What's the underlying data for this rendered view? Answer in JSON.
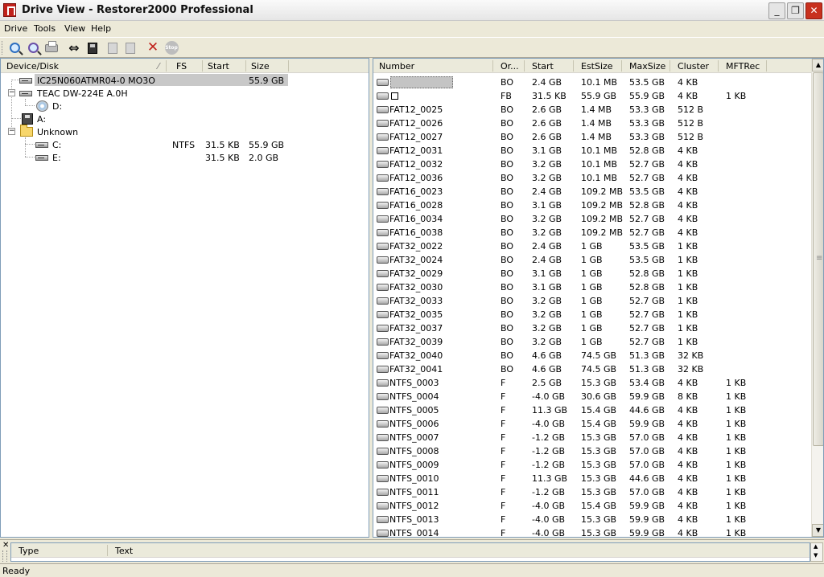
{
  "window": {
    "title": "Drive View - Restorer2000 Professional",
    "minimize_label": "_",
    "maximize_label": "❐",
    "close_label": "✕"
  },
  "menu": [
    "Drive",
    "Tools",
    "View",
    "Help"
  ],
  "toolbar": {
    "icons": [
      "find-partitions-icon",
      "find-files-icon",
      "print-icon",
      "swap-icon",
      "open-disk-icon",
      "copy-disabled-icon",
      "paste-disabled-icon",
      "delete-icon",
      "stop-icon"
    ],
    "swap_glyph": "⇔",
    "delete_glyph": "✕",
    "stop_glyph": "Stop"
  },
  "tree": {
    "headers": [
      "Device/Disk",
      "FS",
      "Start",
      "Size"
    ],
    "sort_glyph": "⁄",
    "expander_glyph": "−",
    "rows": [
      {
        "label": "IC25N060ATMR04-0 MO3O",
        "fs": "",
        "start": "",
        "size": "55.9 GB",
        "icon": "hard-disk-icon"
      },
      {
        "label": "TEAC DW-224E A.0H",
        "fs": "",
        "start": "",
        "size": "",
        "icon": "optical-drive-icon"
      },
      {
        "label": "D:",
        "fs": "",
        "start": "",
        "size": "",
        "icon": "cd-icon"
      },
      {
        "label": "A:",
        "fs": "",
        "start": "",
        "size": "",
        "icon": "floppy-icon"
      },
      {
        "label": "Unknown",
        "fs": "",
        "start": "",
        "size": "",
        "icon": "folder-icon"
      },
      {
        "label": "C:",
        "fs": "NTFS",
        "start": "31.5 KB",
        "size": "55.9 GB",
        "icon": "partition-icon"
      },
      {
        "label": "E:",
        "fs": "",
        "start": "31.5 KB",
        "size": "2.0 GB",
        "icon": "partition-icon"
      }
    ]
  },
  "list": {
    "headers": [
      "Number",
      "Or...",
      "Start",
      "EstSize",
      "MaxSize",
      "Cluster",
      "MFTRec"
    ],
    "rows": [
      {
        "number": "",
        "or": "BO",
        "start": "2.4 GB",
        "est": "10.1 MB",
        "max": "53.5 GB",
        "cluster": "4 KB",
        "mft": ""
      },
      {
        "number": "",
        "or": "FB",
        "start": "31.5 KB",
        "est": "55.9 GB",
        "max": "55.9 GB",
        "cluster": "4 KB",
        "mft": "1 KB"
      },
      {
        "number": "FAT12_0025",
        "or": "BO",
        "start": "2.6 GB",
        "est": "1.4 MB",
        "max": "53.3 GB",
        "cluster": "512 B",
        "mft": ""
      },
      {
        "number": "FAT12_0026",
        "or": "BO",
        "start": "2.6 GB",
        "est": "1.4 MB",
        "max": "53.3 GB",
        "cluster": "512 B",
        "mft": ""
      },
      {
        "number": "FAT12_0027",
        "or": "BO",
        "start": "2.6 GB",
        "est": "1.4 MB",
        "max": "53.3 GB",
        "cluster": "512 B",
        "mft": ""
      },
      {
        "number": "FAT12_0031",
        "or": "BO",
        "start": "3.1 GB",
        "est": "10.1 MB",
        "max": "52.8 GB",
        "cluster": "4 KB",
        "mft": ""
      },
      {
        "number": "FAT12_0032",
        "or": "BO",
        "start": "3.2 GB",
        "est": "10.1 MB",
        "max": "52.7 GB",
        "cluster": "4 KB",
        "mft": ""
      },
      {
        "number": "FAT12_0036",
        "or": "BO",
        "start": "3.2 GB",
        "est": "10.1 MB",
        "max": "52.7 GB",
        "cluster": "4 KB",
        "mft": ""
      },
      {
        "number": "FAT16_0023",
        "or": "BO",
        "start": "2.4 GB",
        "est": "109.2 MB",
        "max": "53.5 GB",
        "cluster": "4 KB",
        "mft": ""
      },
      {
        "number": "FAT16_0028",
        "or": "BO",
        "start": "3.1 GB",
        "est": "109.2 MB",
        "max": "52.8 GB",
        "cluster": "4 KB",
        "mft": ""
      },
      {
        "number": "FAT16_0034",
        "or": "BO",
        "start": "3.2 GB",
        "est": "109.2 MB",
        "max": "52.7 GB",
        "cluster": "4 KB",
        "mft": ""
      },
      {
        "number": "FAT16_0038",
        "or": "BO",
        "start": "3.2 GB",
        "est": "109.2 MB",
        "max": "52.7 GB",
        "cluster": "4 KB",
        "mft": ""
      },
      {
        "number": "FAT32_0022",
        "or": "BO",
        "start": "2.4 GB",
        "est": "1 GB",
        "max": "53.5 GB",
        "cluster": "1 KB",
        "mft": ""
      },
      {
        "number": "FAT32_0024",
        "or": "BO",
        "start": "2.4 GB",
        "est": "1 GB",
        "max": "53.5 GB",
        "cluster": "1 KB",
        "mft": ""
      },
      {
        "number": "FAT32_0029",
        "or": "BO",
        "start": "3.1 GB",
        "est": "1 GB",
        "max": "52.8 GB",
        "cluster": "1 KB",
        "mft": ""
      },
      {
        "number": "FAT32_0030",
        "or": "BO",
        "start": "3.1 GB",
        "est": "1 GB",
        "max": "52.8 GB",
        "cluster": "1 KB",
        "mft": ""
      },
      {
        "number": "FAT32_0033",
        "or": "BO",
        "start": "3.2 GB",
        "est": "1 GB",
        "max": "52.7 GB",
        "cluster": "1 KB",
        "mft": ""
      },
      {
        "number": "FAT32_0035",
        "or": "BO",
        "start": "3.2 GB",
        "est": "1 GB",
        "max": "52.7 GB",
        "cluster": "1 KB",
        "mft": ""
      },
      {
        "number": "FAT32_0037",
        "or": "BO",
        "start": "3.2 GB",
        "est": "1 GB",
        "max": "52.7 GB",
        "cluster": "1 KB",
        "mft": ""
      },
      {
        "number": "FAT32_0039",
        "or": "BO",
        "start": "3.2 GB",
        "est": "1 GB",
        "max": "52.7 GB",
        "cluster": "1 KB",
        "mft": ""
      },
      {
        "number": "FAT32_0040",
        "or": "BO",
        "start": "4.6 GB",
        "est": "74.5 GB",
        "max": "51.3 GB",
        "cluster": "32 KB",
        "mft": ""
      },
      {
        "number": "FAT32_0041",
        "or": "BO",
        "start": "4.6 GB",
        "est": "74.5 GB",
        "max": "51.3 GB",
        "cluster": "32 KB",
        "mft": ""
      },
      {
        "number": "NTFS_0003",
        "or": "F",
        "start": "2.5 GB",
        "est": "15.3 GB",
        "max": "53.4 GB",
        "cluster": "4 KB",
        "mft": "1 KB"
      },
      {
        "number": "NTFS_0004",
        "or": "F",
        "start": "-4.0 GB",
        "est": "30.6 GB",
        "max": "59.9 GB",
        "cluster": "8 KB",
        "mft": "1 KB"
      },
      {
        "number": "NTFS_0005",
        "or": "F",
        "start": "11.3 GB",
        "est": "15.4 GB",
        "max": "44.6 GB",
        "cluster": "4 KB",
        "mft": "1 KB"
      },
      {
        "number": "NTFS_0006",
        "or": "F",
        "start": "-4.0 GB",
        "est": "15.4 GB",
        "max": "59.9 GB",
        "cluster": "4 KB",
        "mft": "1 KB"
      },
      {
        "number": "NTFS_0007",
        "or": "F",
        "start": "-1.2 GB",
        "est": "15.3 GB",
        "max": "57.0 GB",
        "cluster": "4 KB",
        "mft": "1 KB"
      },
      {
        "number": "NTFS_0008",
        "or": "F",
        "start": "-1.2 GB",
        "est": "15.3 GB",
        "max": "57.0 GB",
        "cluster": "4 KB",
        "mft": "1 KB"
      },
      {
        "number": "NTFS_0009",
        "or": "F",
        "start": "-1.2 GB",
        "est": "15.3 GB",
        "max": "57.0 GB",
        "cluster": "4 KB",
        "mft": "1 KB"
      },
      {
        "number": "NTFS_0010",
        "or": "F",
        "start": "11.3 GB",
        "est": "15.3 GB",
        "max": "44.6 GB",
        "cluster": "4 KB",
        "mft": "1 KB"
      },
      {
        "number": "NTFS_0011",
        "or": "F",
        "start": "-1.2 GB",
        "est": "15.3 GB",
        "max": "57.0 GB",
        "cluster": "4 KB",
        "mft": "1 KB"
      },
      {
        "number": "NTFS_0012",
        "or": "F",
        "start": "-4.0 GB",
        "est": "15.4 GB",
        "max": "59.9 GB",
        "cluster": "4 KB",
        "mft": "1 KB"
      },
      {
        "number": "NTFS_0013",
        "or": "F",
        "start": "-4.0 GB",
        "est": "15.3 GB",
        "max": "59.9 GB",
        "cluster": "4 KB",
        "mft": "1 KB"
      },
      {
        "number": "NTFS_0014",
        "or": "F",
        "start": "-4.0 GB",
        "est": "15.3 GB",
        "max": "59.9 GB",
        "cluster": "4 KB",
        "mft": "1 KB"
      }
    ],
    "scroll_up_glyph": "▲",
    "scroll_down_glyph": "▼"
  },
  "bottom_panel": {
    "close_glyph": "✕",
    "headers": [
      "Type",
      "Text"
    ],
    "scroll_up_glyph": "▲",
    "scroll_down_glyph": "▼"
  },
  "status": {
    "text": "Ready"
  }
}
